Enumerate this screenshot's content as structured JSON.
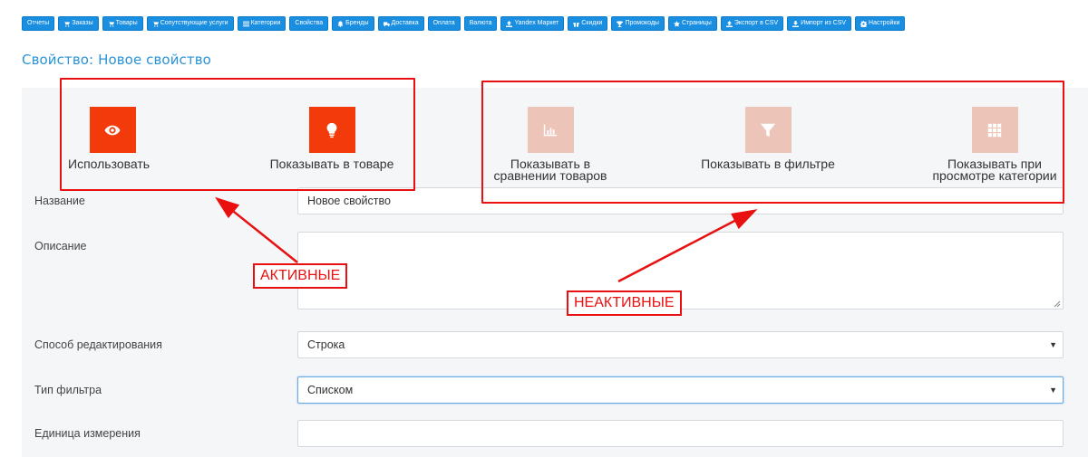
{
  "nav": {
    "items": [
      {
        "label": "Отчеты",
        "icon": ""
      },
      {
        "label": "Заказы",
        "icon": "cart-icon"
      },
      {
        "label": "Товары",
        "icon": "cart-icon"
      },
      {
        "label": "Сопутствующие услуги",
        "icon": "cart-icon"
      },
      {
        "label": "Категории",
        "icon": "list-icon"
      },
      {
        "label": "Свойства",
        "icon": ""
      },
      {
        "label": "Бренды",
        "icon": "bell-icon"
      },
      {
        "label": "Доставка",
        "icon": "truck-icon"
      },
      {
        "label": "Оплата",
        "icon": ""
      },
      {
        "label": "Валюта",
        "icon": ""
      },
      {
        "label": "Yandex Маркет",
        "icon": "upload-icon"
      },
      {
        "label": "Скидки",
        "icon": "gift-icon"
      },
      {
        "label": "Промокоды",
        "icon": "trophy-icon"
      },
      {
        "label": "Страницы",
        "icon": "star-icon"
      },
      {
        "label": "Экспорт в CSV",
        "icon": "upload-icon"
      },
      {
        "label": "Импорт из CSV",
        "icon": "download-icon"
      },
      {
        "label": "Настройки",
        "icon": "gear-icon"
      }
    ]
  },
  "page": {
    "title": "Свойство: Новое свойство"
  },
  "toggles": [
    {
      "label": "Использовать",
      "icon": "eye-icon",
      "active": true
    },
    {
      "label": "Показывать в товаре",
      "icon": "lightbulb-icon",
      "active": true
    },
    {
      "label": "Показывать в сравнении товаров",
      "icon": "bar-chart-icon",
      "active": false
    },
    {
      "label": "Показывать в фильтре",
      "icon": "filter-icon",
      "active": false
    },
    {
      "label": "Показывать при просмотре категории",
      "icon": "grid-icon",
      "active": false
    }
  ],
  "form": {
    "name": {
      "label": "Название",
      "value": "Новое свойство"
    },
    "description": {
      "label": "Описание",
      "value": ""
    },
    "edit_mode": {
      "label": "Способ редактирования",
      "value": "Строка"
    },
    "filter_type": {
      "label": "Тип фильтра",
      "value": "Списком"
    },
    "unit": {
      "label": "Единица измерения",
      "value": ""
    }
  },
  "annotations": {
    "active": "АКТИВНЫЕ",
    "inactive": "НЕАКТИВНЫЕ",
    "color": "#e81010"
  },
  "colors": {
    "nav_button": "#1a8ee1",
    "title": "#2a93d5",
    "tile_active": "#f33a0b",
    "tile_inactive": "#edc4b8"
  }
}
